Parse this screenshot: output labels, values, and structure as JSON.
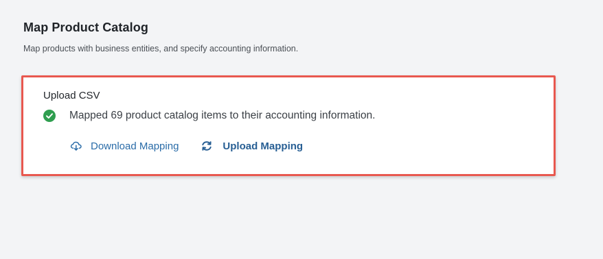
{
  "page": {
    "title": "Map Product Catalog",
    "subtitle": "Map products with business entities, and specify accounting information."
  },
  "upload_section": {
    "title": "Upload CSV",
    "status_icon": "check-circle-icon",
    "status_text": "Mapped 69 product catalog items to their accounting information.",
    "download_icon": "cloud-download-icon",
    "download_label": "Download Mapping",
    "upload_icon": "refresh-icon",
    "upload_label": "Upload Mapping"
  },
  "colors": {
    "background": "#f3f4f6",
    "highlight_border": "#e8584f",
    "success": "#2f9e4f",
    "link": "#2a6ca8",
    "link_bold": "#285f94"
  }
}
